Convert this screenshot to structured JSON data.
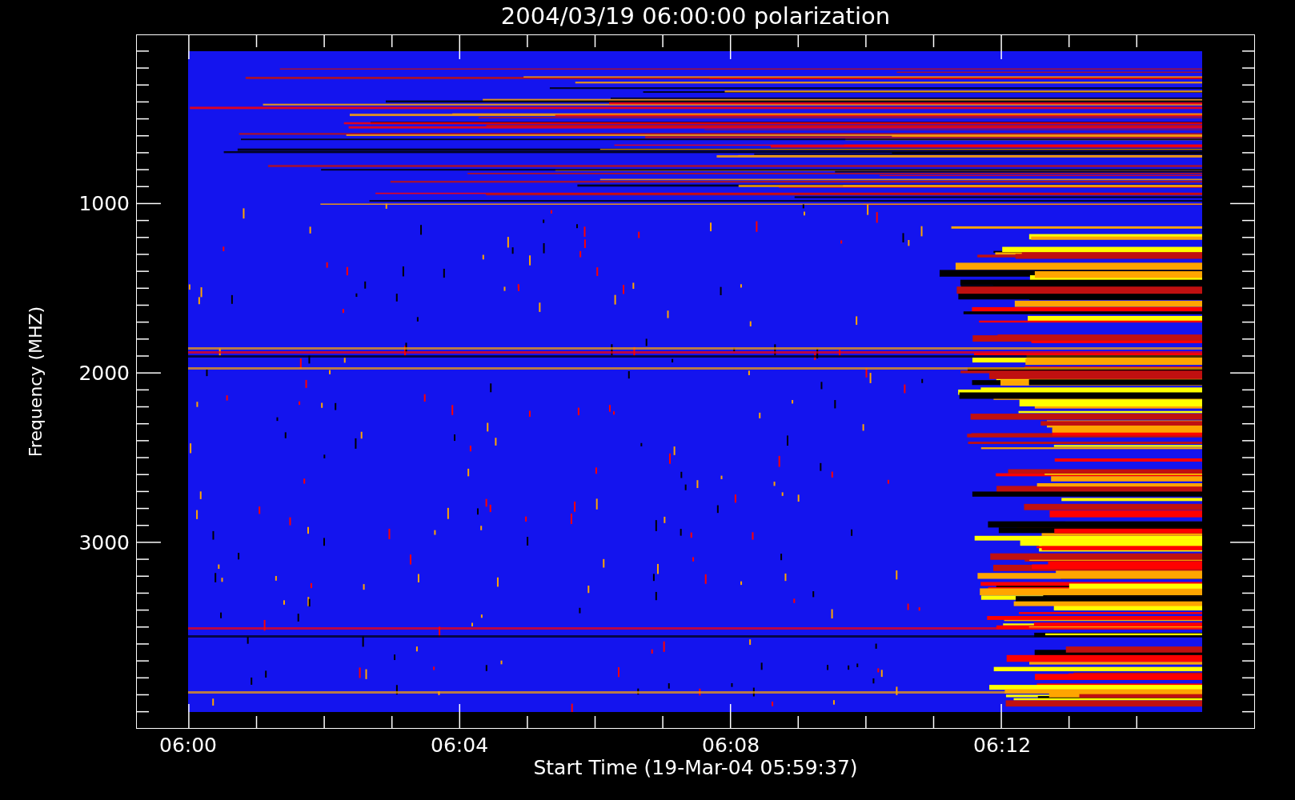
{
  "title": "2004/03/19 06:00:00 polarization",
  "y_axis": {
    "label": "Frequency (MHZ)",
    "ticks": [
      "1000",
      "2000",
      "3000"
    ]
  },
  "x_axis": {
    "label": "Start Time (19-Mar-04 05:59:37)",
    "ticks": [
      "06:00",
      "06:04",
      "06:08",
      "06:12"
    ]
  }
}
